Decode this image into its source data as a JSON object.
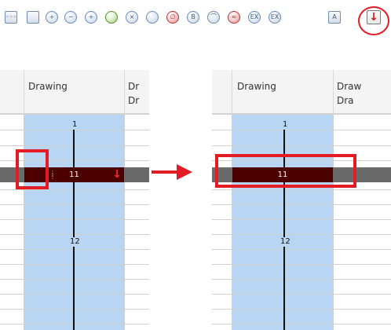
{
  "headers": {
    "drawing_label": "Drawing",
    "right_label_left": "Dr",
    "right_label_left_second": "Dr",
    "right_label_right": "Draw",
    "right_label_right_second": "Dra"
  },
  "left_cells": {
    "top_number": "1",
    "selected_number": "11",
    "lower_number": "12"
  },
  "right_cells": {
    "top_number": "1",
    "selected_number": "11",
    "lower_number": "12"
  },
  "toolbar": {
    "tools": [
      {
        "icon": "frame-dots-icon",
        "glyph": "◦◦◦"
      },
      {
        "icon": "layer-panel-icon",
        "glyph": ""
      },
      {
        "icon": "add-keyframe-icon",
        "glyph": "+"
      },
      {
        "icon": "remove-keyframe-icon",
        "glyph": "−"
      },
      {
        "icon": "insert-frame-icon",
        "glyph": "+"
      },
      {
        "icon": "clone-drawing-icon",
        "glyph": ""
      },
      {
        "icon": "close-drawing-icon",
        "glyph": "×"
      },
      {
        "icon": "drawing-tool-icon",
        "glyph": ""
      },
      {
        "icon": "stop-icon",
        "glyph": "∅"
      },
      {
        "icon": "drawing-b-icon",
        "glyph": "B"
      },
      {
        "icon": "curve-icon",
        "glyph": "⌒"
      },
      {
        "icon": "red-curve-icon",
        "glyph": "≈"
      },
      {
        "icon": "expand-icon",
        "glyph": "EX"
      },
      {
        "icon": "expand-alt-icon",
        "glyph": "EX"
      },
      {
        "icon": "a-tool-icon",
        "glyph": "A"
      },
      {
        "icon": "select-arrow-icon",
        "glyph": "↓"
      }
    ]
  },
  "colors": {
    "accent": "#e31b23",
    "selected_cell": "#4d0000",
    "column_fill": "#b8d5f3"
  }
}
